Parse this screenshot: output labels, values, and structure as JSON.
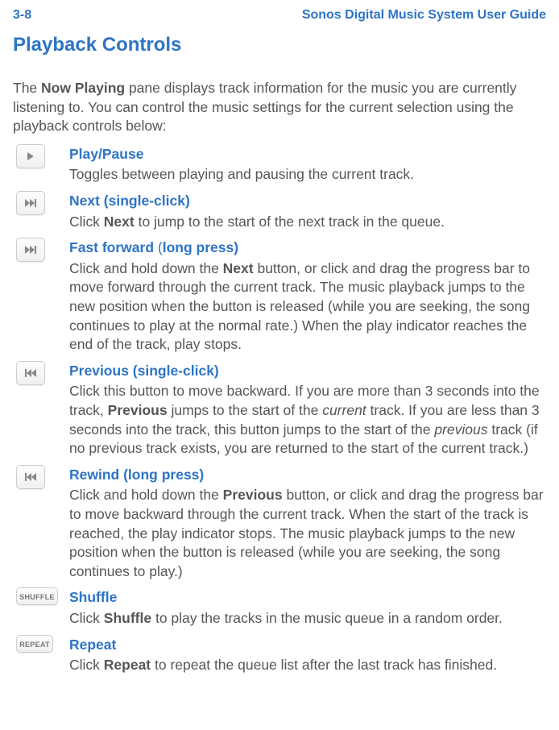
{
  "header": {
    "pageNumber": "3-8",
    "guideTitle": "Sonos Digital Music System User Guide"
  },
  "sectionTitle": "Playback Controls",
  "intro_pre": "The ",
  "intro_bold": "Now Playing",
  "intro_post": " pane displays track information for the music you are currently listening to. You can control the music settings for the current selection using the playback controls below:",
  "items": {
    "play": {
      "title": "Play/Pause",
      "desc": "Toggles between playing and pausing the current track."
    },
    "next": {
      "title": "Next (single-click)",
      "desc_pre": "Click ",
      "desc_b1": "Next",
      "desc_post": " to jump to the start of the next track in the queue."
    },
    "ff": {
      "title_a": "Fast forward ",
      "title_paren": "(",
      "title_b": "long press)",
      "desc_pre": "Click and hold down the ",
      "desc_b1": "Next",
      "desc_post": " button, or click and drag the progress bar to move forward through the current track. The music playback jumps to the new position when the button is released (while you are seeking, the song continues to play at the normal rate.) When the play indicator reaches the end of the track, play stops."
    },
    "prev": {
      "title": "Previous (single-click)",
      "desc_pre": "Click this button to move backward. If you are more than 3 seconds into the track, ",
      "desc_b1": "Previous",
      "desc_mid1": " jumps to the start of the ",
      "desc_i1": "current",
      "desc_mid2": " track. If you are less than 3 seconds into the track, this button jumps to the start of the ",
      "desc_i2": "previous",
      "desc_post": " track (if no previous track exists, you are returned to the start of the current track.)"
    },
    "rew": {
      "title": "Rewind (long press)",
      "desc_pre": "Click and hold down the ",
      "desc_b1": "Previous",
      "desc_post": " button, or click and drag the progress bar to move backward through the current track. When the start of the track is reached, the play indicator stops. The music playback jumps to the new position when the button is released (while you are seeking, the song continues to play.)"
    },
    "shuffle": {
      "btn": "SHUFFLE",
      "title": "Shuffle",
      "desc_pre": "Click ",
      "desc_b1": "Shuffle",
      "desc_post": " to play the tracks in the music queue in a random order."
    },
    "repeat": {
      "btn": "REPEAT",
      "title": "Repeat",
      "desc_pre": "Click ",
      "desc_b1": "Repeat",
      "desc_post": " to repeat the queue list after the last track has finished."
    }
  }
}
